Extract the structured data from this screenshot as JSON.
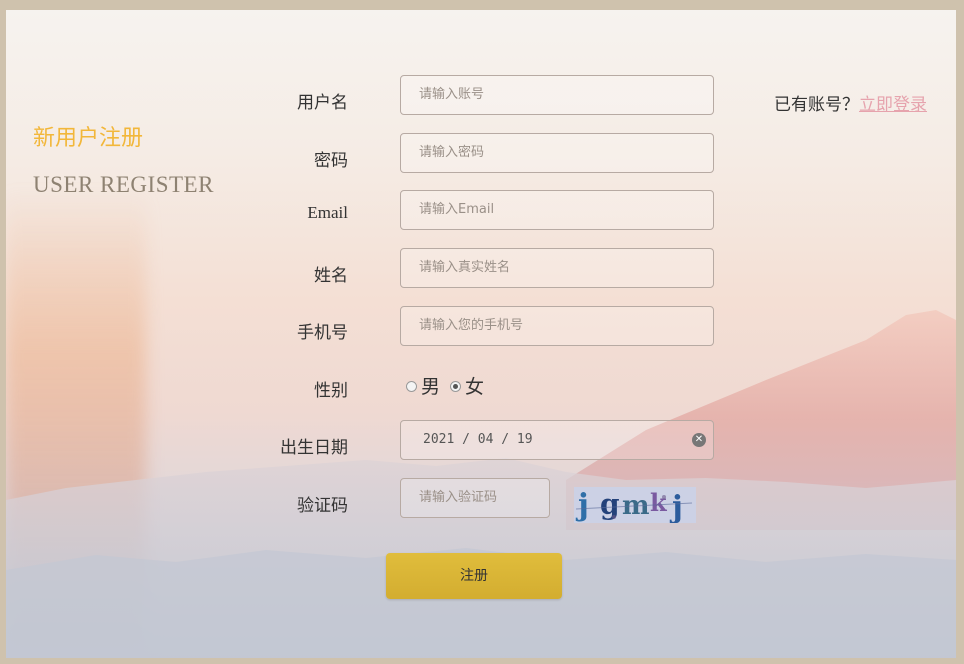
{
  "side": {
    "title_cn": "新用户注册",
    "title_en": "USER REGISTER"
  },
  "login": {
    "prompt": "已有账号？",
    "link_label": "立即登录"
  },
  "form": {
    "username": {
      "label": "用户名",
      "placeholder": "请输入账号"
    },
    "password": {
      "label": "密码",
      "placeholder": "请输入密码"
    },
    "email": {
      "label": "Email",
      "placeholder": "请输入Email"
    },
    "realname": {
      "label": "姓名",
      "placeholder": "请输入真实姓名"
    },
    "phone": {
      "label": "手机号",
      "placeholder": "请输入您的手机号"
    },
    "gender": {
      "label": "性别",
      "options": [
        "男",
        "女"
      ],
      "selected": "女"
    },
    "birthday": {
      "label": "出生日期",
      "value": "2021 / 04 / 19"
    },
    "captcha": {
      "label": "验证码",
      "placeholder": "请输入验证码",
      "image_text": "jgmkj"
    },
    "submit_label": "注册"
  },
  "colors": {
    "accent_title": "#f2b73a",
    "link": "#e6a3ad",
    "button": "#d9b536"
  }
}
